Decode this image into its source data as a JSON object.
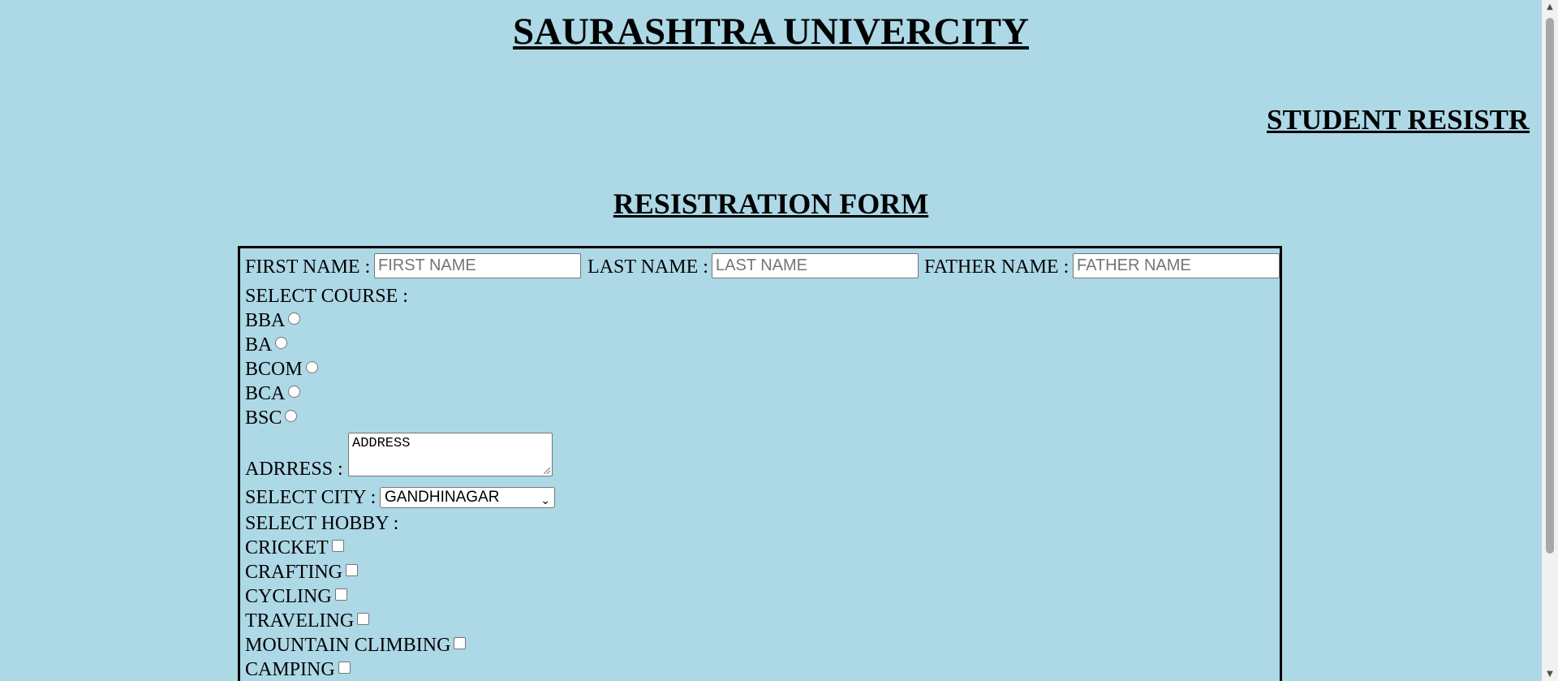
{
  "header": {
    "title": "SAURASHTRA UNIVERCITY",
    "marquee": "STUDENT RESISTRATION"
  },
  "form": {
    "heading": "RESISTRATION FORM",
    "first_name_label": "FIRST NAME :",
    "first_name_placeholder": "FIRST NAME",
    "last_name_label": "LAST NAME :",
    "last_name_placeholder": "LAST NAME",
    "father_name_label": "FATHER NAME :",
    "father_name_placeholder": "FATHER NAME",
    "course_label": "SELECT COURSE :",
    "courses": [
      "BBA",
      "BA",
      "BCOM",
      "BCA",
      "BSC"
    ],
    "address_label": "ADRRESS :",
    "address_value": "ADDRESS",
    "city_label": "SELECT CITY :",
    "city_selected": "GANDHINAGAR",
    "hobby_label": "SELECT HOBBY :",
    "hobbies": [
      "CRICKET",
      "CRAFTING",
      "CYCLING",
      "TRAVELING",
      "MOUNTAIN CLIMBING",
      "CAMPING"
    ]
  },
  "icons": {
    "select_chevron": "chevron-down-icon",
    "scroll_up": "scroll-up-arrow-icon",
    "scroll_down": "scroll-down-arrow-icon",
    "textarea_resize": "resize-grip-icon"
  },
  "colors": {
    "background": "#add8e6",
    "border": "#000000"
  }
}
